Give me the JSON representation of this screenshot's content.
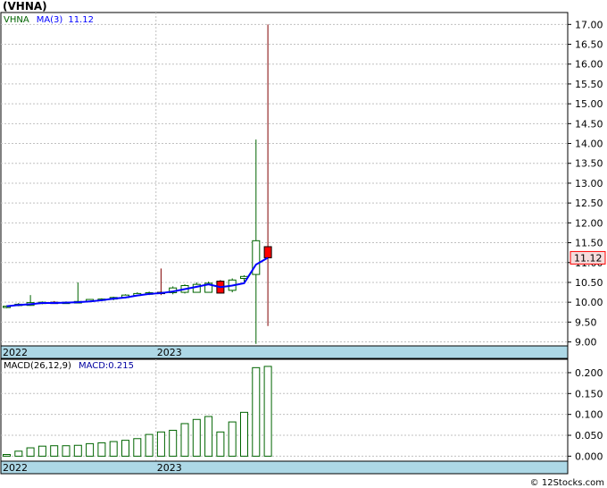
{
  "ticker": "(VHNA)",
  "credit": "© 12Stocks.com",
  "colors": {
    "up": "#006400",
    "down": "#ff0000",
    "ma": "#0000ff",
    "macd": "#006400",
    "axis_band": "#add8e6",
    "grid": "#c0c0c0"
  },
  "chart_data": [
    {
      "type": "candlestick",
      "legend": {
        "symbol": "VHNA",
        "ma_label": "MA(3)",
        "ma_value": "11.12"
      },
      "current_price": "11.12",
      "ylim": [
        8.9,
        17.3
      ],
      "y_ticks": [
        "17.00",
        "16.50",
        "16.00",
        "15.50",
        "15.00",
        "14.50",
        "14.00",
        "13.50",
        "13.00",
        "12.50",
        "12.00",
        "11.50",
        "11.00",
        "10.50",
        "10.00",
        "9.50",
        "9.00"
      ],
      "x_labels": [
        {
          "label": "2022",
          "index": 0
        },
        {
          "label": "2023",
          "index": 13
        }
      ],
      "candles": [
        {
          "o": 9.9,
          "h": 9.92,
          "l": 9.85,
          "c": 9.9
        },
        {
          "o": 9.93,
          "h": 9.98,
          "l": 9.9,
          "c": 9.95
        },
        {
          "o": 9.92,
          "h": 10.18,
          "l": 9.91,
          "c": 9.99
        },
        {
          "o": 9.98,
          "h": 10.02,
          "l": 9.95,
          "c": 10.0
        },
        {
          "o": 10.0,
          "h": 10.03,
          "l": 9.97,
          "c": 9.99
        },
        {
          "o": 9.99,
          "h": 10.02,
          "l": 9.96,
          "c": 10.0
        },
        {
          "o": 9.98,
          "h": 10.5,
          "l": 9.97,
          "c": 10.02
        },
        {
          "o": 10.02,
          "h": 10.08,
          "l": 10.0,
          "c": 10.07
        },
        {
          "o": 10.05,
          "h": 10.1,
          "l": 10.03,
          "c": 10.08
        },
        {
          "o": 10.08,
          "h": 10.14,
          "l": 10.05,
          "c": 10.12
        },
        {
          "o": 10.12,
          "h": 10.2,
          "l": 10.1,
          "c": 10.18
        },
        {
          "o": 10.17,
          "h": 10.25,
          "l": 10.15,
          "c": 10.22
        },
        {
          "o": 10.2,
          "h": 10.27,
          "l": 10.18,
          "c": 10.24
        },
        {
          "o": 10.25,
          "h": 10.85,
          "l": 10.18,
          "c": 10.22
        },
        {
          "o": 10.24,
          "h": 10.4,
          "l": 10.2,
          "c": 10.36
        },
        {
          "o": 10.25,
          "h": 10.45,
          "l": 10.22,
          "c": 10.42
        },
        {
          "o": 10.25,
          "h": 10.5,
          "l": 10.24,
          "c": 10.45
        },
        {
          "o": 10.25,
          "h": 10.52,
          "l": 10.25,
          "c": 10.48
        },
        {
          "o": 10.53,
          "h": 10.56,
          "l": 10.22,
          "c": 10.23
        },
        {
          "o": 10.3,
          "h": 10.6,
          "l": 10.25,
          "c": 10.56
        },
        {
          "o": 10.6,
          "h": 10.68,
          "l": 10.5,
          "c": 10.65
        },
        {
          "o": 10.7,
          "h": 14.1,
          "l": 8.95,
          "c": 11.55
        },
        {
          "o": 11.4,
          "h": 17.0,
          "l": 9.4,
          "c": 11.12
        }
      ],
      "ma": [
        9.9,
        9.93,
        9.95,
        9.98,
        9.98,
        9.99,
        10.0,
        10.02,
        10.05,
        10.09,
        10.12,
        10.17,
        10.21,
        10.23,
        10.27,
        10.33,
        10.39,
        10.45,
        10.38,
        10.42,
        10.48,
        10.95,
        11.12
      ]
    },
    {
      "type": "bar",
      "legend": {
        "label": "MACD(26,12,9)",
        "value_label": "MACD:0.215"
      },
      "ylim": [
        -0.012,
        0.232
      ],
      "y_ticks": [
        "0.200",
        "0.150",
        "0.100",
        "0.050",
        "0.000"
      ],
      "x_labels": [
        {
          "label": "2022",
          "index": 0
        },
        {
          "label": "2023",
          "index": 13
        }
      ],
      "values": [
        0.004,
        0.012,
        0.02,
        0.024,
        0.025,
        0.025,
        0.026,
        0.03,
        0.032,
        0.035,
        0.038,
        0.042,
        0.052,
        0.058,
        0.062,
        0.078,
        0.088,
        0.095,
        0.058,
        0.082,
        0.105,
        0.212,
        0.215
      ]
    }
  ]
}
